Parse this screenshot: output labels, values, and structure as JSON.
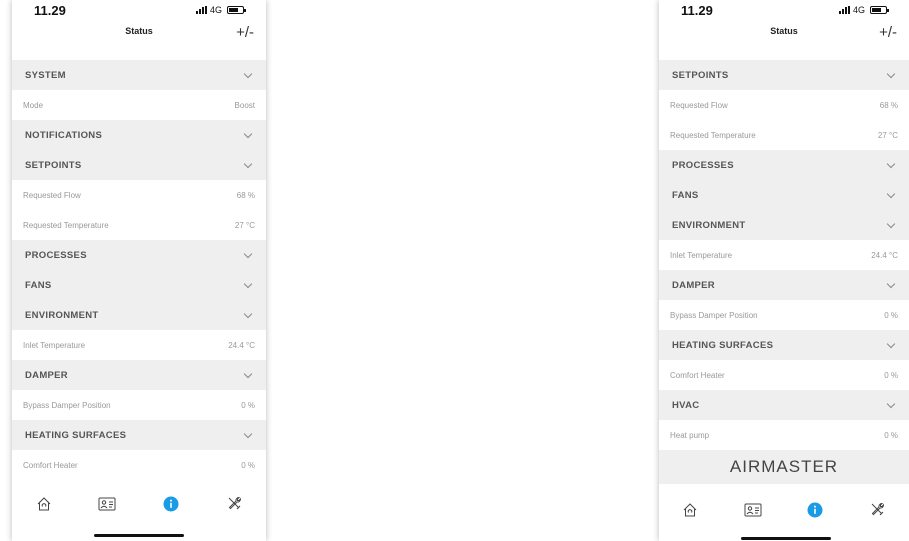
{
  "status_bar": {
    "time": "11.29",
    "network": "4G"
  },
  "nav": {
    "title": "Status",
    "plus_minus": "+/-"
  },
  "left_screen": {
    "items": [
      {
        "kind": "section",
        "title": "SYSTEM"
      },
      {
        "kind": "row",
        "label": "Mode",
        "value": "Boost"
      },
      {
        "kind": "section",
        "title": "NOTIFICATIONS"
      },
      {
        "kind": "section",
        "title": "SETPOINTS"
      },
      {
        "kind": "row",
        "label": "Requested Flow",
        "value": "68 %"
      },
      {
        "kind": "row",
        "label": "Requested Temperature",
        "value": "27 °C"
      },
      {
        "kind": "section",
        "title": "PROCESSES"
      },
      {
        "kind": "section",
        "title": "FANS"
      },
      {
        "kind": "section",
        "title": "ENVIRONMENT"
      },
      {
        "kind": "row",
        "label": "Inlet Temperature",
        "value": "24.4 °C"
      },
      {
        "kind": "section",
        "title": "DAMPER"
      },
      {
        "kind": "row",
        "label": "Bypass Damper Position",
        "value": "0 %"
      },
      {
        "kind": "section",
        "title": "HEATING SURFACES"
      },
      {
        "kind": "row",
        "label": "Comfort Heater",
        "value": "0 %"
      }
    ]
  },
  "right_screen": {
    "items": [
      {
        "kind": "section",
        "title": "SETPOINTS"
      },
      {
        "kind": "row",
        "label": "Requested Flow",
        "value": "68 %"
      },
      {
        "kind": "row",
        "label": "Requested Temperature",
        "value": "27 °C"
      },
      {
        "kind": "section",
        "title": "PROCESSES"
      },
      {
        "kind": "section",
        "title": "FANS"
      },
      {
        "kind": "section",
        "title": "ENVIRONMENT"
      },
      {
        "kind": "row",
        "label": "Inlet Temperature",
        "value": "24.4 °C"
      },
      {
        "kind": "section",
        "title": "DAMPER"
      },
      {
        "kind": "row",
        "label": "Bypass Damper Position",
        "value": "0 %"
      },
      {
        "kind": "section",
        "title": "HEATING SURFACES"
      },
      {
        "kind": "row",
        "label": "Comfort Heater",
        "value": "0 %"
      },
      {
        "kind": "section",
        "title": "HVAC"
      },
      {
        "kind": "row",
        "label": "Heat pump",
        "value": "0 %"
      }
    ],
    "brand": "AIRMASTER"
  },
  "tabbar": {
    "tabs": [
      {
        "icon": "home-icon"
      },
      {
        "icon": "profile-card-icon"
      },
      {
        "icon": "info-icon",
        "active": true
      },
      {
        "icon": "tools-icon"
      }
    ]
  },
  "colors": {
    "accent": "#1a9be6",
    "section_bg": "#efefef"
  }
}
